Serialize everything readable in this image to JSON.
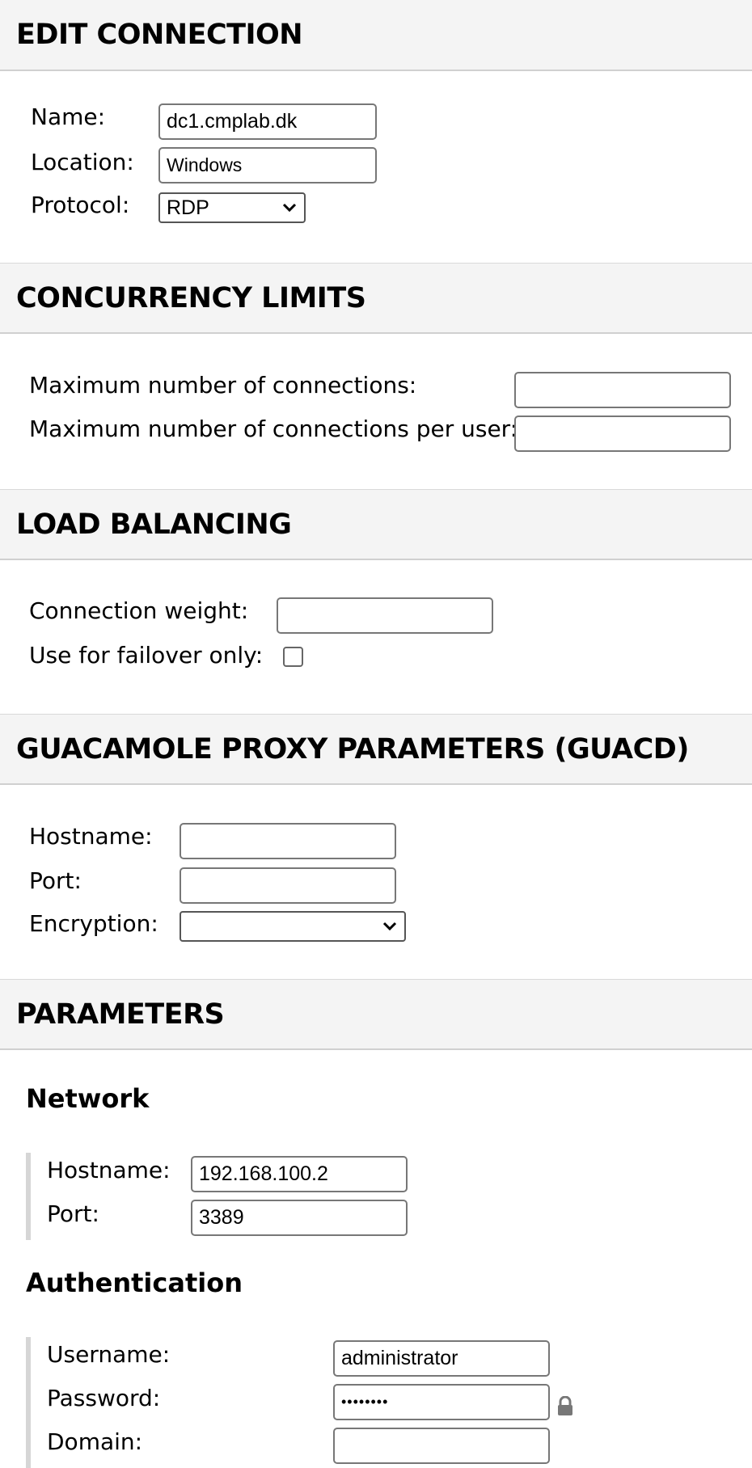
{
  "edit_connection": {
    "title": "EDIT CONNECTION",
    "name_label": "Name:",
    "name_value": "dc1.cmplab.dk",
    "location_label": "Location:",
    "location_value": "Windows",
    "protocol_label": "Protocol:",
    "protocol_value": "RDP"
  },
  "concurrency": {
    "title": "CONCURRENCY LIMITS",
    "max_connections_label": "Maximum number of connections:",
    "max_connections_value": "",
    "max_per_user_label": "Maximum number of connections per user:",
    "max_per_user_value": ""
  },
  "load_balancing": {
    "title": "LOAD BALANCING",
    "weight_label": "Connection weight:",
    "weight_value": "",
    "failover_label": "Use for failover only:",
    "failover_checked": false
  },
  "guacd": {
    "title": "GUACAMOLE PROXY PARAMETERS (GUACD)",
    "hostname_label": "Hostname:",
    "hostname_value": "",
    "port_label": "Port:",
    "port_value": "",
    "encryption_label": "Encryption:",
    "encryption_value": ""
  },
  "parameters": {
    "title": "PARAMETERS",
    "network": {
      "title": "Network",
      "hostname_label": "Hostname:",
      "hostname_value": "192.168.100.2",
      "port_label": "Port:",
      "port_value": "3389"
    },
    "authentication": {
      "title": "Authentication",
      "username_label": "Username:",
      "username_value": "administrator",
      "password_label": "Password:",
      "password_value": "••••••••",
      "domain_label": "Domain:",
      "domain_value": ""
    }
  }
}
